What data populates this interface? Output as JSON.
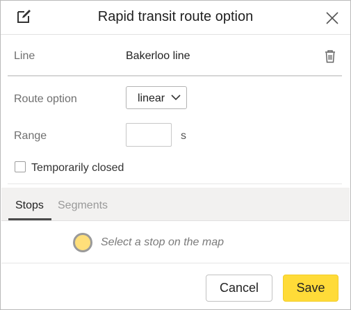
{
  "dialog": {
    "title": "Rapid transit route option",
    "edit_icon": "edit-icon",
    "close_icon": "close-icon"
  },
  "line": {
    "label": "Line",
    "value": "Bakerloo line",
    "delete_icon": "trash-icon"
  },
  "route_option": {
    "label": "Route option",
    "selected": "linear"
  },
  "range": {
    "label": "Range",
    "value": "",
    "unit": "s"
  },
  "temporarily_closed": {
    "label": "Temporarily closed",
    "checked": false
  },
  "tabs": [
    {
      "label": "Stops",
      "active": true
    },
    {
      "label": "Segments",
      "active": false
    }
  ],
  "stops_panel": {
    "hint": "Select a stop on the map",
    "marker_color": "#ffdf7a"
  },
  "footer": {
    "cancel_label": "Cancel",
    "save_label": "Save"
  },
  "colors": {
    "save_button": "#ffdb38",
    "tab_bar": "#f2f1f0"
  }
}
